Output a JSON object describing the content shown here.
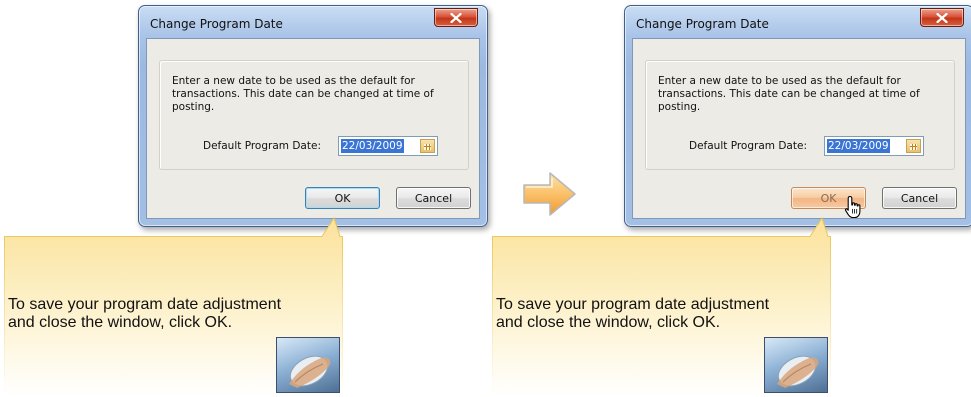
{
  "panels": [
    {
      "state": "before",
      "dialog": {
        "title": "Change Program Date",
        "description": "Enter a new date to be used as the default for transactions. This date can be changed at time of posting.",
        "date_label": "Default Program Date:",
        "date_value": "22/03/2009",
        "ok_label": "OK",
        "cancel_label": "Cancel"
      },
      "callout": {
        "line1": "To save your program date adjustment",
        "line2": "and close the window, click OK."
      }
    },
    {
      "state": "after",
      "dialog": {
        "title": "Change Program Date",
        "description": "Enter a new date to be used as the default for transactions. This date can be changed at time of posting.",
        "date_label": "Default Program Date:",
        "date_value": "22/03/2009",
        "ok_label": "OK",
        "cancel_label": "Cancel"
      },
      "callout": {
        "line1": "To save your program date adjustment",
        "line2": "and close the window, click OK."
      }
    }
  ],
  "icons": {
    "close": "close-x-icon",
    "calendar": "calendar-icon",
    "arrow": "right-arrow-icon",
    "cursor": "hand-pointer-icon",
    "thumbnail": "mouse-hand-icon"
  },
  "colors": {
    "window_frame": "#a3bfe4",
    "client_bg": "#ecebe5",
    "close_red": "#c23619",
    "date_highlight": "#3a74d5",
    "ok_hover": "#f3b585",
    "callout_yellow": "#fbe08a",
    "arrow_fill": "#f7b25a"
  }
}
